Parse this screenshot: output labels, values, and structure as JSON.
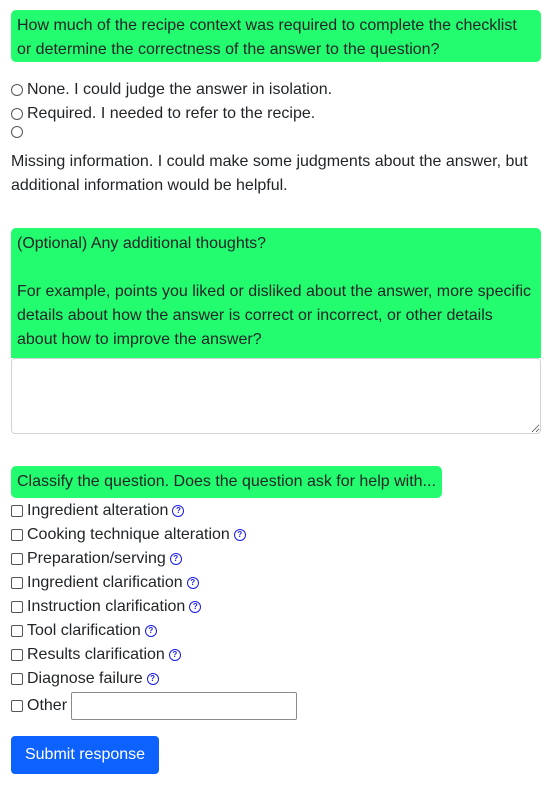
{
  "context_question": {
    "prompt": "How much of the recipe context was required to complete the checklist or determine the correctness of the answer to the question?",
    "options": [
      {
        "label": "None. I could judge the answer in isolation."
      },
      {
        "label": "Required. I needed to refer to the recipe."
      },
      {
        "label": "Missing information. I could make some judgments about the answer, but additional information would be helpful."
      }
    ]
  },
  "thoughts_question": {
    "prompt": "(Optional) Any additional thoughts?",
    "example": "For example, points you liked or disliked about the answer, more specific details about how the answer is correct or incorrect, or other details about how to improve the answer?",
    "value": ""
  },
  "classify_question": {
    "prompt": "Classify the question. Does the question ask for help with...",
    "help_symbol": "?",
    "options": [
      {
        "label": "Ingredient alteration"
      },
      {
        "label": "Cooking technique alteration"
      },
      {
        "label": "Preparation/serving"
      },
      {
        "label": "Ingredient clarification"
      },
      {
        "label": "Instruction clarification"
      },
      {
        "label": "Tool clarification"
      },
      {
        "label": "Results clarification"
      },
      {
        "label": "Diagnose failure"
      }
    ],
    "other_label": "Other",
    "other_value": ""
  },
  "submit_label": "Submit response",
  "colors": {
    "highlight": "#22fc6e",
    "accent": "#0d62fd",
    "help_icon": "#1a1aee"
  }
}
